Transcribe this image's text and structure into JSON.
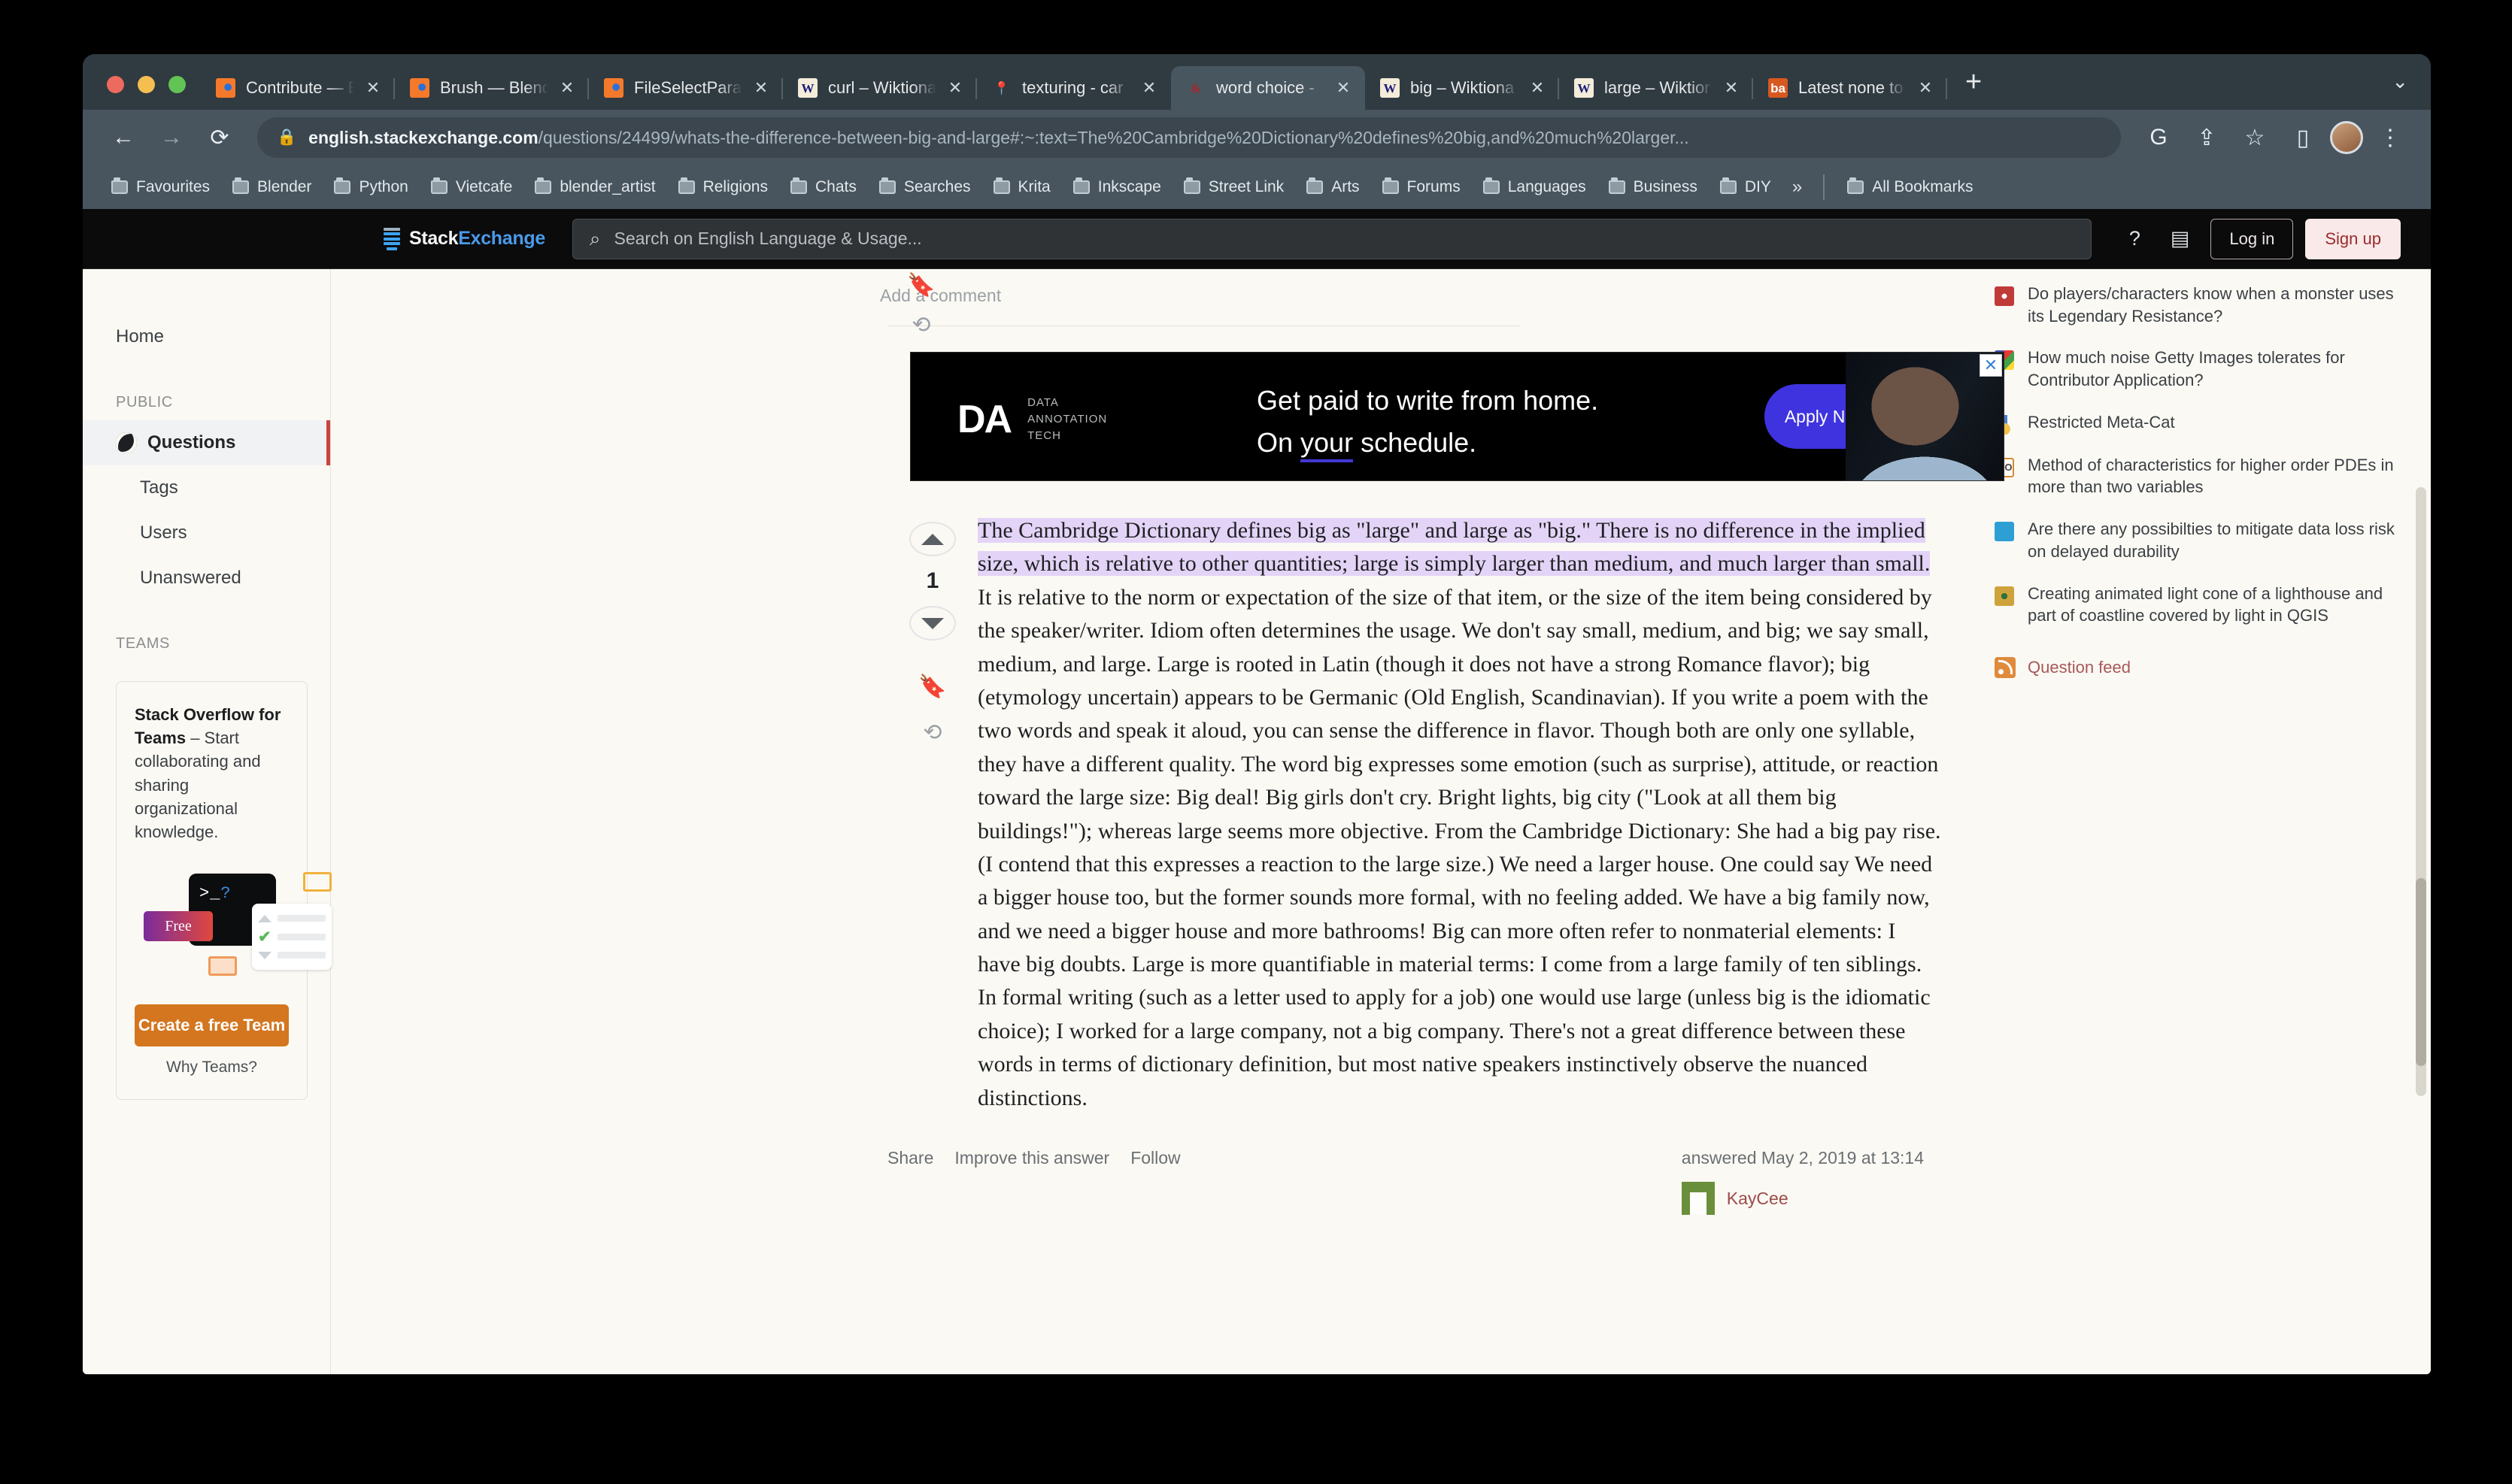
{
  "browser": {
    "tabs": [
      {
        "label": "Contribute — B",
        "favicon": "blender-icon",
        "active": false
      },
      {
        "label": "Brush — Blend",
        "favicon": "blender-icon",
        "active": false
      },
      {
        "label": "FileSelectPara",
        "favicon": "blender-icon",
        "active": false
      },
      {
        "label": "curl – Wiktiona",
        "favicon": "wiktionary-icon",
        "active": false
      },
      {
        "label": "texturing - car",
        "favicon": "map-pin-icon",
        "active": false
      },
      {
        "label": "word choice -",
        "favicon": "stackexchange-icon",
        "active": true
      },
      {
        "label": "big – Wiktiona",
        "favicon": "wiktionary-icon",
        "active": false
      },
      {
        "label": "large – Wiktior",
        "favicon": "wiktionary-icon",
        "active": false
      },
      {
        "label": "Latest none to",
        "favicon": "ba-icon",
        "active": false
      }
    ],
    "new_tab_label": "+",
    "tab_list_chevron": "⌄",
    "nav": {
      "back": "←",
      "forward": "→",
      "reload": "⟳",
      "lock": "🔒",
      "url_host": "english.stackexchange.com",
      "url_path": "/questions/24499/whats-the-difference-between-big-and-large#:~:text=The%20Cambridge%20Dictionary%20defines%20big,and%20much%20larger...",
      "translate": "G",
      "share": "⇪",
      "bookmark_star": "☆",
      "sidepanel": "▯",
      "menu": "⋮"
    },
    "bookmarks": [
      "Favourites",
      "Blender",
      "Python",
      "Vietcafe",
      "blender_artist",
      "Religions",
      "Chats",
      "Searches",
      "Krita",
      "Inkscape",
      "Street Link",
      "Arts",
      "Forums",
      "Languages",
      "Business",
      "DIY"
    ],
    "bookmarks_overflow": "»",
    "all_bookmarks": "All Bookmarks"
  },
  "site": {
    "logo_a": "Stack",
    "logo_b": "Exchange",
    "search_placeholder": "Search on English Language & Usage...",
    "help_icon": "question-circle-icon",
    "inbox_icon": "inbox-icon",
    "login_label": "Log in",
    "signup_label": "Sign up"
  },
  "sidebar": {
    "home": "Home",
    "public_header": "PUBLIC",
    "items": [
      {
        "label": "Questions",
        "active": true
      },
      {
        "label": "Tags",
        "active": false
      },
      {
        "label": "Users",
        "active": false
      },
      {
        "label": "Unanswered",
        "active": false
      }
    ],
    "teams_header": "TEAMS",
    "teams_card": {
      "title": "Stack Overflow for Teams",
      "body": " – Start collaborating and sharing organizational knowledge.",
      "art_terminal": ">_",
      "art_terminal_q": "?",
      "art_free": "Free",
      "cta": "Create a free Team",
      "why": "Why Teams?"
    }
  },
  "content": {
    "add_comment": "Add a comment",
    "ad": {
      "brand": "DA",
      "brand_sub_1": "DATA",
      "brand_sub_2": "ANNOTATION",
      "brand_sub_3": "TECH",
      "line1": "Get paid to write from home.",
      "line2_pre": "On ",
      "line2_u": "your",
      "line2_post": " schedule.",
      "cta": "Apply Now!",
      "close": "✕"
    },
    "answer": {
      "vote_count": "1",
      "upvote_icon": "caret-up-icon",
      "downvote_icon": "caret-down-icon",
      "bookmark_icon": "bookmark-icon",
      "history_icon": "history-icon",
      "highlighted_text": "The Cambridge Dictionary defines big as \"large\" and large as \"big.\" There is no difference in the implied size, which is relative to other quantities; large is simply larger than medium, and much larger than small.",
      "body_rest": "It is relative to the norm or expectation of the size of that item, or the size of the item being considered by the speaker/writer. Idiom often determines the usage. We don't say small, medium, and big; we say small, medium, and large. Large is rooted in Latin (though it does not have a strong Romance flavor); big (etymology uncertain) appears to be Germanic (Old English, Scandinavian). If you write a poem with the two words and speak it aloud, you can sense the difference in flavor. Though both are only one syllable, they have a different quality. The word big expresses some emotion (such as surprise), attitude, or reaction toward the large size: Big deal! Big girls don't cry. Bright lights, big city (\"Look at all them big buildings!\"); whereas large seems more objective. From the Cambridge Dictionary: She had a big pay rise. (I contend that this expresses a reaction to the large size.) We need a larger house. One could say We need a bigger house too, but the former sounds more formal, with no feeling added. We have a big family now, and we need a bigger house and more bathrooms! Big can more often refer to nonmaterial elements: I have big doubts. Large is more quantifiable in material terms: I come from a large family of ten siblings. In formal writing (such as a letter used to apply for a job) one would use large (unless big is the idiomatic choice); I worked for a large company, not a big company. There's not a great difference between these words in terms of dictionary definition, but most native speakers instinctively observe the nuanced distinctions.",
      "share": "Share",
      "improve": "Improve this answer",
      "follow": "Follow",
      "answered": "answered May 2, 2019 at 13:14",
      "author": "KayCee"
    }
  },
  "right_column": {
    "related": [
      {
        "icon": "dnd-dice-icon",
        "text": "Do players/characters know when a monster uses its Legendary Resistance?"
      },
      {
        "icon": "photo-se-icon",
        "text": "How much noise Getty Images tolerates for Contributor Application?"
      },
      {
        "icon": "meta-medal-icon",
        "text": "Restricted Meta-Cat"
      },
      {
        "icon": "mathoverflow-icon",
        "text": "Method of characteristics for higher order PDEs in more than two variables"
      },
      {
        "icon": "database-icon",
        "text": "Are there any possibilties to mitigate data loss risk on delayed durability"
      },
      {
        "icon": "qgis-icon",
        "text": "Creating animated light cone of a lighthouse and part of coastline covered by light in QGIS"
      }
    ],
    "feed_label": "Question feed",
    "feed_icon": "rss-icon"
  }
}
